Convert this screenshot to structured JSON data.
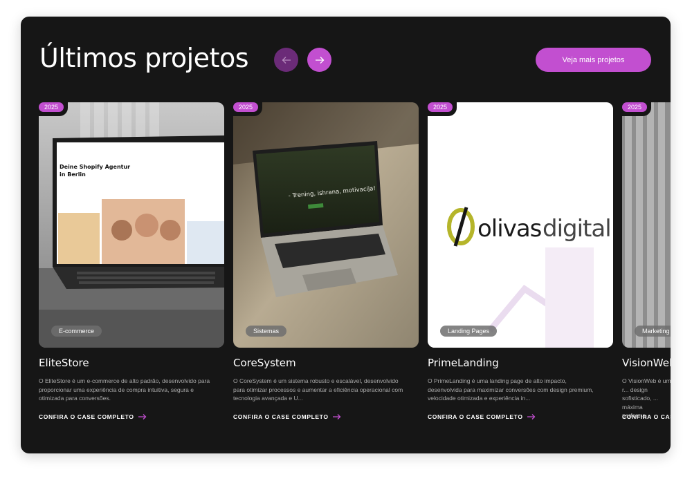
{
  "header": {
    "title": "Últimos projetos",
    "prev_icon": "arrow-left-icon",
    "next_icon": "arrow-right-icon",
    "more_label": "Veja mais projetos"
  },
  "colors": {
    "accent": "#c24fd0",
    "accent_dark": "#6b2b78",
    "panel_bg": "#161616"
  },
  "projects": [
    {
      "year": "2025",
      "category": "E-commerce",
      "title": "EliteStore",
      "description": "O EliteStore é um e-commerce de alto padrão, desenvolvido para proporcionar uma experiência de compra intuitiva, segura e otimizada para conversões.",
      "link": "CONFIRA O CASE COMPLETO",
      "screen_headline": "Deine Shopify Agentur in Berlin"
    },
    {
      "year": "2025",
      "category": "Sistemas",
      "title": "CoreSystem",
      "description": "O CoreSystem é um sistema robusto e escalável, desenvolvido para otimizar processos e aumentar a eficiência operacional com tecnologia avançada e U...",
      "link": "CONFIRA O CASE COMPLETO",
      "screen_headline": "- Trening, ishrana, motivacija!"
    },
    {
      "year": "2025",
      "category": "Landing Pages",
      "title": "PrimeLanding",
      "description": "O PrimeLanding é uma landing page de alto impacto, desenvolvida para maximizar conversões com design premium, velocidade otimizada e experiência in...",
      "link": "CONFIRA O CASE COMPLETO",
      "logo_text_a": "olivas",
      "logo_text_b": "digital"
    },
    {
      "year": "2025",
      "category": "Marketing",
      "title": "VisionWeb",
      "description": "O VisionWeb é um r... design sofisticado, ... máxima performa...",
      "link": "CONFIRA O CASE COMPLETO"
    }
  ]
}
